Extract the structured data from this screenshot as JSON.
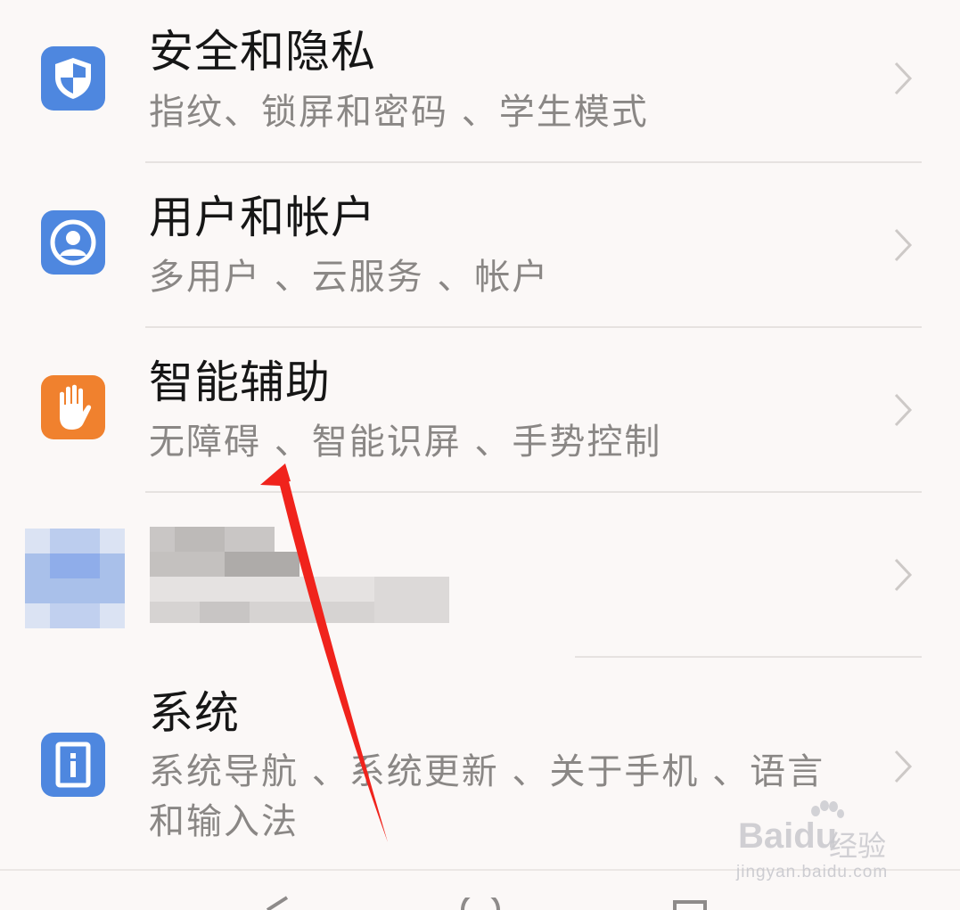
{
  "settings": {
    "items": [
      {
        "title": "安全和隐私",
        "subtitle": "指纹、锁屏和密码 、学生模式",
        "icon": "shield-icon",
        "icon_color": "#4e87df"
      },
      {
        "title": "用户和帐户",
        "subtitle": "多用户 、云服务 、帐户",
        "icon": "user-icon",
        "icon_color": "#4e87df"
      },
      {
        "title": "智能辅助",
        "subtitle": "无障碍 、智能识屏 、手势控制",
        "icon": "hand-icon",
        "icon_color": "#f0812e"
      },
      {
        "title": "",
        "subtitle": "",
        "icon": "blurred-icon",
        "icon_color": "#9db8e8"
      },
      {
        "title": "系统",
        "subtitle": "系统导航 、系统更新 、关于手机 、语言和输入法",
        "icon": "info-icon",
        "icon_color": "#4e87df"
      }
    ]
  },
  "annotation": {
    "arrow_color": "#f0231c"
  },
  "watermark": {
    "brand": "Bai",
    "brand2": "du",
    "cn": "经验",
    "url": "jingyan.baidu.com"
  },
  "nav": {
    "buttons": [
      "back-icon",
      "home-icon",
      "recents-icon"
    ]
  }
}
